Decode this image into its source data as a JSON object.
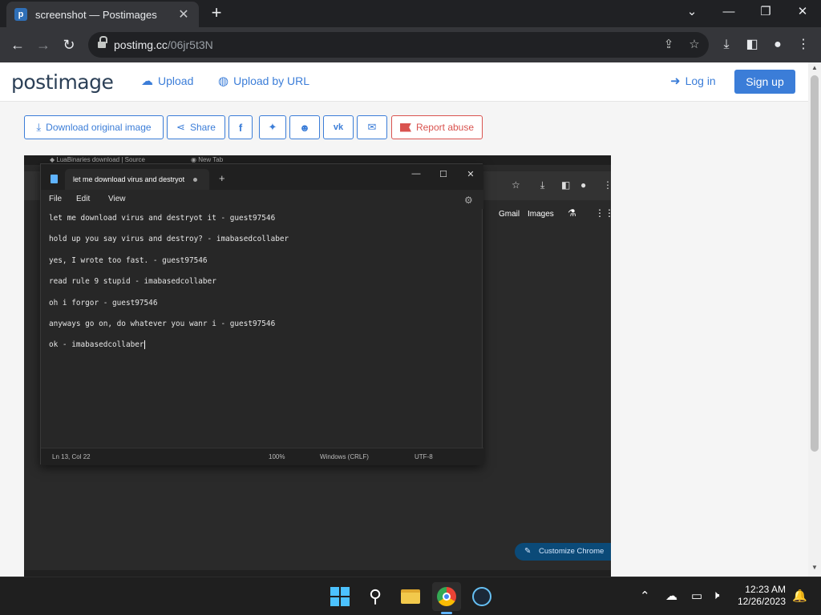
{
  "browser": {
    "tab_title": "screenshot — Postimages",
    "favicon_letter": "p",
    "url_host": "postimg.cc",
    "url_path": "/06jr5t3N"
  },
  "site": {
    "logo_prefix": "post",
    "logo_suffix": "image",
    "upload_label": "Upload",
    "upload_url_label": "Upload by URL",
    "login_label": "Log in",
    "signup_label": "Sign up",
    "brand_color": "#3b7dd8"
  },
  "actions": {
    "download_label": "Download original image",
    "share_label": "Share",
    "report_label": "Report abuse"
  },
  "screenshot": {
    "tab1": "LuaBinaries download | Source",
    "tab2": "New Tab",
    "gmail": "Gmail",
    "images": "Images",
    "customize": "Customize Chrome",
    "notepad": {
      "tab_title": "let me download virus and destryot",
      "menu": [
        "File",
        "Edit",
        "View"
      ],
      "lines": [
        "let me download virus and destryot it - guest97546",
        "hold up you say virus and destroy? - imabasedcollaber",
        "yes, I wrote too fast. - guest97546",
        "read rule 9 stupid - imabasedcollaber",
        "oh i forgor - guest97546",
        "anyways go on, do whatever you wanr i - guest97546",
        "ok - imabasedcollaber"
      ],
      "status": {
        "position": "Ln 13, Col 22",
        "zoom": "100%",
        "line_ending": "Windows (CRLF)",
        "encoding": "UTF-8"
      }
    }
  },
  "taskbar": {
    "time": "12:23 AM",
    "date": "12/26/2023"
  }
}
